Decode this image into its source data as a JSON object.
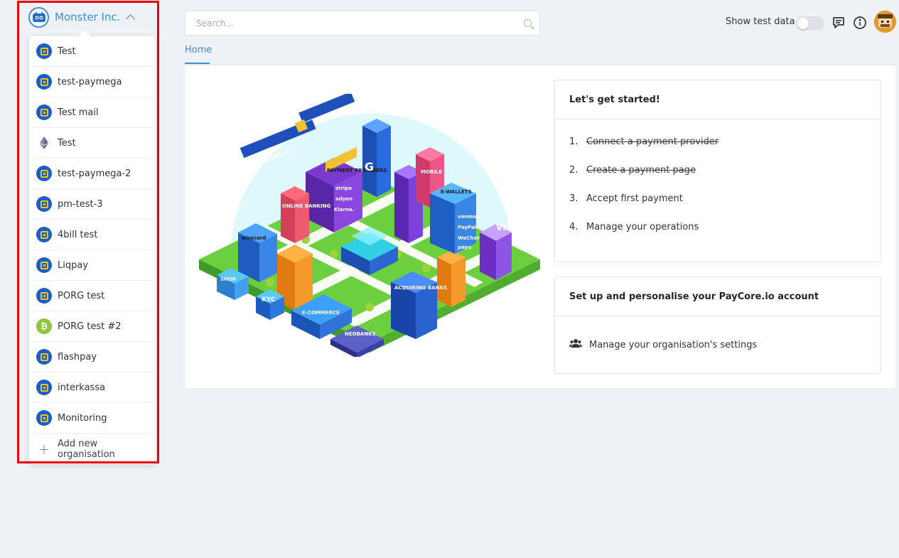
{
  "org": {
    "name": "Monster Inc.",
    "items": [
      {
        "label": "Test",
        "icon": "paycore-square-icon"
      },
      {
        "label": "test-paymega",
        "icon": "paycore-square-icon"
      },
      {
        "label": "Test mail",
        "icon": "paycore-square-icon"
      },
      {
        "label": "Test",
        "icon": "ethereum-icon"
      },
      {
        "label": "test-paymega-2",
        "icon": "paycore-square-icon"
      },
      {
        "label": "pm-test-3",
        "icon": "paycore-square-icon"
      },
      {
        "label": "4bill test",
        "icon": "paycore-square-icon"
      },
      {
        "label": "Liqpay",
        "icon": "paycore-square-icon"
      },
      {
        "label": "PORG test",
        "icon": "paycore-square-icon"
      },
      {
        "label": "PORG test #2",
        "icon": "bitcoin-icon"
      },
      {
        "label": "flashpay",
        "icon": "paycore-square-icon"
      },
      {
        "label": "interkassa",
        "icon": "paycore-square-icon"
      },
      {
        "label": "Monitoring",
        "icon": "paycore-square-icon"
      }
    ],
    "add_label": "Add new organisation",
    "bitcoin_glyph": "₿"
  },
  "search": {
    "placeholder": "Search..."
  },
  "topbar": {
    "show_test_data": "Show test data",
    "test_data_on": false
  },
  "tabs": {
    "home": "Home"
  },
  "illustration": {
    "satellite_text": "PAYCORE.IO",
    "signs": [
      "PAYMENT PROVIDERS",
      "stripe",
      "adyen",
      "Klarna.",
      "ONLINE BANKING",
      "MOBILE",
      "E-WALLETS",
      "venmo",
      "PayPal",
      "WeChat",
      "payu",
      "VISA",
      "wirecard",
      "SHOP",
      "KYC",
      "E-COMMERCE",
      "NEOBANKS",
      "ACQUIRING BANKS",
      "G"
    ]
  },
  "started": {
    "title": "Let's get started!",
    "steps": [
      {
        "num": "1.",
        "text": "Connect a payment provider",
        "done": true
      },
      {
        "num": "2.",
        "text": "Create a payment page",
        "done": true
      },
      {
        "num": "3.",
        "text": "Accept first payment",
        "done": false
      },
      {
        "num": "4.",
        "text": "Manage your operations",
        "done": false
      }
    ]
  },
  "account": {
    "title": "Set up and personalise your PayCore.io account",
    "settings_link": "Manage your organisation's settings"
  },
  "colors": {
    "accent": "#3f8ed9",
    "highlight": "#e8000b",
    "paycore_blue": "#1a5fc9",
    "paycore_yellow": "#f1c40f",
    "bitcoin_green": "#8dc641"
  }
}
